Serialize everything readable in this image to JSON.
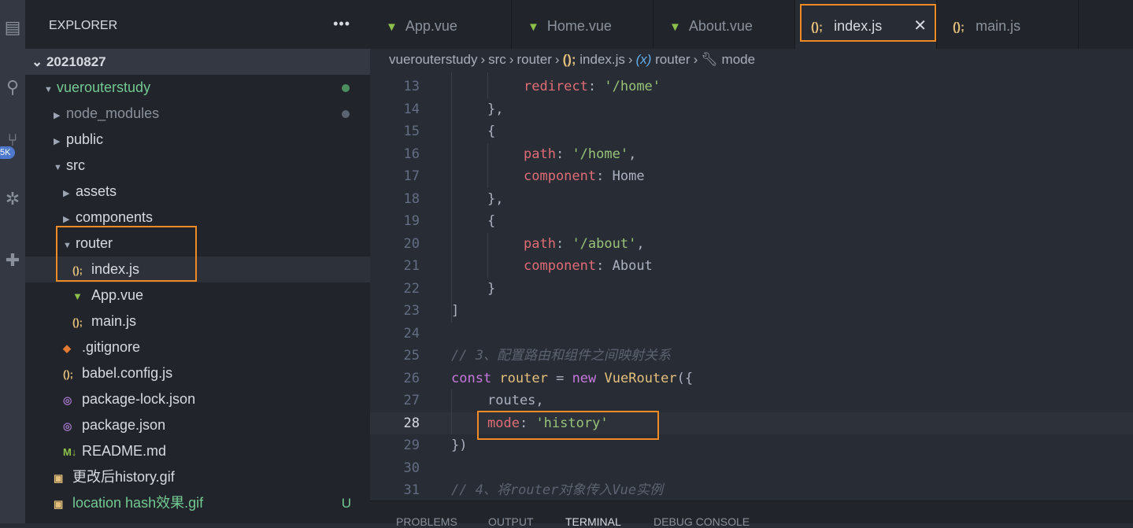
{
  "activity": {
    "badge": "5K",
    "icons": [
      "files-icon",
      "search-icon",
      "source-control-icon",
      "debug-icon",
      "extensions-icon"
    ]
  },
  "sidebar": {
    "title": "EXPLORER",
    "more": "•••",
    "root": "20210827",
    "items": [
      {
        "label": "vuerouterstudy",
        "depth": 0,
        "twisty": "open",
        "color": "#73c991",
        "dot": "#4b8f5e"
      },
      {
        "label": "node_modules",
        "depth": 1,
        "twisty": "closed",
        "color": "#8b919c",
        "dot": "#5c6370"
      },
      {
        "label": "public",
        "depth": 1,
        "twisty": "closed"
      },
      {
        "label": "src",
        "depth": 1,
        "twisty": "open"
      },
      {
        "label": "assets",
        "depth": 2,
        "twisty": "closed"
      },
      {
        "label": "components",
        "depth": 2,
        "twisty": "closed"
      },
      {
        "label": "router",
        "depth": 2,
        "twisty": "open"
      },
      {
        "label": "index.js",
        "depth": 3,
        "icon": "js",
        "selected": true
      },
      {
        "label": "App.vue",
        "depth": 3,
        "icon": "vue"
      },
      {
        "label": "main.js",
        "depth": 3,
        "icon": "js"
      },
      {
        "label": ".gitignore",
        "depth": 2,
        "icon": "git"
      },
      {
        "label": "babel.config.js",
        "depth": 2,
        "icon": "js"
      },
      {
        "label": "package-lock.json",
        "depth": 2,
        "icon": "json"
      },
      {
        "label": "package.json",
        "depth": 2,
        "icon": "json"
      },
      {
        "label": "README.md",
        "depth": 2,
        "icon": "md"
      },
      {
        "label": "更改后history.gif",
        "depth": 1,
        "icon": "img"
      },
      {
        "label": "location hash效果.gif",
        "depth": 1,
        "icon": "img",
        "color": "#73c991",
        "status": "U"
      }
    ]
  },
  "tabs": [
    {
      "label": "App.vue",
      "icon": "vue"
    },
    {
      "label": "Home.vue",
      "icon": "vue"
    },
    {
      "label": "About.vue",
      "icon": "vue"
    },
    {
      "label": "index.js",
      "icon": "js",
      "active": true,
      "close": "✕"
    },
    {
      "label": "main.js",
      "icon": "js"
    }
  ],
  "breadcrumb": [
    "vuerouterstudy",
    "src",
    "router",
    "index.js",
    "router",
    "mode"
  ],
  "code": [
    {
      "n": "13",
      "i": 2,
      "t": [
        [
          "p",
          "redirect"
        ],
        [
          "o",
          ": "
        ],
        [
          "s",
          "'/home'"
        ]
      ]
    },
    {
      "n": "14",
      "i": 1,
      "t": [
        [
          "o",
          "},"
        ]
      ]
    },
    {
      "n": "15",
      "i": 1,
      "t": [
        [
          "o",
          "{"
        ]
      ]
    },
    {
      "n": "16",
      "i": 2,
      "t": [
        [
          "p",
          "path"
        ],
        [
          "o",
          ": "
        ],
        [
          "s",
          "'/home'"
        ],
        [
          "o",
          ","
        ]
      ]
    },
    {
      "n": "17",
      "i": 2,
      "t": [
        [
          "p",
          "component"
        ],
        [
          "o",
          ": "
        ],
        [
          "o",
          "Home"
        ]
      ]
    },
    {
      "n": "18",
      "i": 1,
      "t": [
        [
          "o",
          "},"
        ]
      ]
    },
    {
      "n": "19",
      "i": 1,
      "t": [
        [
          "o",
          "{"
        ]
      ]
    },
    {
      "n": "20",
      "i": 2,
      "t": [
        [
          "p",
          "path"
        ],
        [
          "o",
          ": "
        ],
        [
          "s",
          "'/about'"
        ],
        [
          "o",
          ","
        ]
      ]
    },
    {
      "n": "21",
      "i": 2,
      "t": [
        [
          "p",
          "component"
        ],
        [
          "o",
          ": "
        ],
        [
          "o",
          "About"
        ]
      ]
    },
    {
      "n": "22",
      "i": 1,
      "t": [
        [
          "o",
          "}"
        ]
      ]
    },
    {
      "n": "23",
      "i": 0,
      "t": [
        [
          "o",
          "]"
        ]
      ]
    },
    {
      "n": "24",
      "i": 0,
      "t": []
    },
    {
      "n": "25",
      "i": 0,
      "t": [
        [
          "cm",
          "// 3、配置路由和组件之间映射关系"
        ]
      ]
    },
    {
      "n": "26",
      "i": 0,
      "t": [
        [
          "k",
          "const "
        ],
        [
          "t",
          "router"
        ],
        [
          "o",
          " = "
        ],
        [
          "k",
          "new "
        ],
        [
          "t",
          "VueRouter"
        ],
        [
          "o",
          "({"
        ]
      ]
    },
    {
      "n": "27",
      "i": 1,
      "t": [
        [
          "o",
          "routes,"
        ]
      ]
    },
    {
      "n": "28",
      "i": 1,
      "t": [
        [
          "p",
          "mode"
        ],
        [
          "o",
          ": "
        ],
        [
          "s",
          "'history'"
        ]
      ],
      "current": true
    },
    {
      "n": "29",
      "i": 0,
      "t": [
        [
          "o",
          "})"
        ]
      ]
    },
    {
      "n": "30",
      "i": 0,
      "t": []
    },
    {
      "n": "31",
      "i": 0,
      "t": [
        [
          "cm",
          "// 4、将router对象传入Vue实例"
        ]
      ]
    }
  ],
  "panel": {
    "tabs": [
      "PROBLEMS",
      "OUTPUT",
      "TERMINAL",
      "DEBUG CONSOLE"
    ],
    "active": "TERMINAL"
  },
  "colors": {
    "highlight": "#f08a24",
    "vue": "#8dc149",
    "js": "#e5c07b"
  }
}
